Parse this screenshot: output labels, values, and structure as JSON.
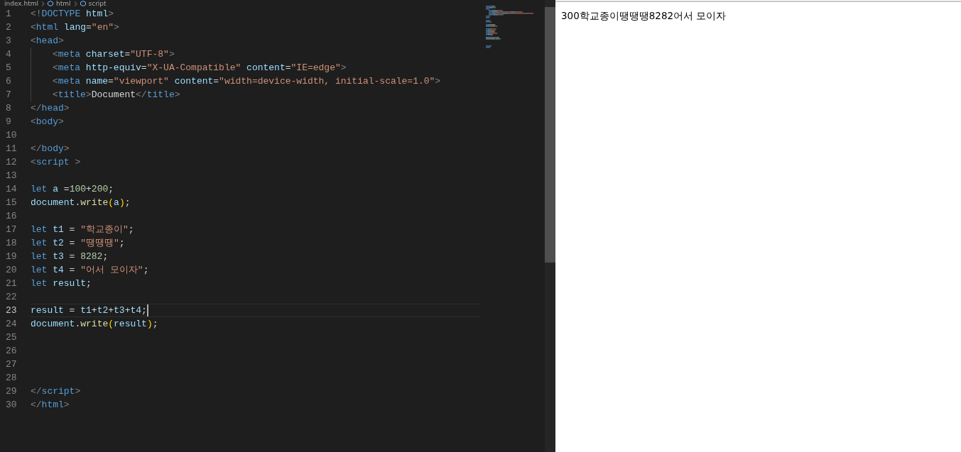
{
  "breadcrumb": [
    "index.html",
    "html",
    "script"
  ],
  "editor": {
    "lines": [
      {
        "number": "1",
        "indented": false,
        "selected": false,
        "tokens": [
          {
            "kind": "punct",
            "text": "<!"
          },
          {
            "kind": "tag",
            "text": "DOCTYPE"
          },
          {
            "kind": "attr",
            "text": " html"
          },
          {
            "kind": "punct",
            "text": ">"
          }
        ]
      },
      {
        "number": "2",
        "indented": false,
        "selected": false,
        "tokens": [
          {
            "kind": "punct",
            "text": "<"
          },
          {
            "kind": "tag",
            "text": "html"
          },
          {
            "kind": "attr",
            "text": " lang"
          },
          {
            "kind": "plain",
            "text": "="
          },
          {
            "kind": "string",
            "text": "\"en\""
          },
          {
            "kind": "punct",
            "text": ">"
          }
        ]
      },
      {
        "number": "3",
        "indented": false,
        "selected": false,
        "tokens": [
          {
            "kind": "punct",
            "text": "<"
          },
          {
            "kind": "tag",
            "text": "head"
          },
          {
            "kind": "punct",
            "text": ">"
          }
        ]
      },
      {
        "number": "4",
        "indented": true,
        "selected": false,
        "tokens": [
          {
            "kind": "punct",
            "text": "<"
          },
          {
            "kind": "tag",
            "text": "meta"
          },
          {
            "kind": "attr",
            "text": " charset"
          },
          {
            "kind": "plain",
            "text": "="
          },
          {
            "kind": "string",
            "text": "\"UTF-8\""
          },
          {
            "kind": "punct",
            "text": ">"
          }
        ]
      },
      {
        "number": "5",
        "indented": true,
        "selected": false,
        "tokens": [
          {
            "kind": "punct",
            "text": "<"
          },
          {
            "kind": "tag",
            "text": "meta"
          },
          {
            "kind": "attr",
            "text": " http-equiv"
          },
          {
            "kind": "plain",
            "text": "="
          },
          {
            "kind": "string",
            "text": "\"X-UA-Compatible\""
          },
          {
            "kind": "attr",
            "text": " content"
          },
          {
            "kind": "plain",
            "text": "="
          },
          {
            "kind": "string",
            "text": "\"IE=edge\""
          },
          {
            "kind": "punct",
            "text": ">"
          }
        ]
      },
      {
        "number": "6",
        "indented": true,
        "selected": false,
        "tokens": [
          {
            "kind": "punct",
            "text": "<"
          },
          {
            "kind": "tag",
            "text": "meta"
          },
          {
            "kind": "attr",
            "text": " name"
          },
          {
            "kind": "plain",
            "text": "="
          },
          {
            "kind": "string",
            "text": "\"viewport\""
          },
          {
            "kind": "attr",
            "text": " content"
          },
          {
            "kind": "plain",
            "text": "="
          },
          {
            "kind": "string",
            "text": "\"width=device-width, initial-scale=1.0\""
          },
          {
            "kind": "punct",
            "text": ">"
          }
        ]
      },
      {
        "number": "7",
        "indented": true,
        "selected": false,
        "tokens": [
          {
            "kind": "punct",
            "text": "<"
          },
          {
            "kind": "tag",
            "text": "title"
          },
          {
            "kind": "punct",
            "text": ">"
          },
          {
            "kind": "plain",
            "text": "Document"
          },
          {
            "kind": "punct",
            "text": "</"
          },
          {
            "kind": "tag",
            "text": "title"
          },
          {
            "kind": "punct",
            "text": ">"
          }
        ]
      },
      {
        "number": "8",
        "indented": false,
        "selected": false,
        "tokens": [
          {
            "kind": "punct",
            "text": "</"
          },
          {
            "kind": "tag",
            "text": "head"
          },
          {
            "kind": "punct",
            "text": ">"
          }
        ]
      },
      {
        "number": "9",
        "indented": false,
        "selected": false,
        "tokens": [
          {
            "kind": "punct",
            "text": "<"
          },
          {
            "kind": "tag",
            "text": "body"
          },
          {
            "kind": "punct",
            "text": ">"
          }
        ]
      },
      {
        "number": "10",
        "indented": false,
        "selected": false
      },
      {
        "number": "11",
        "indented": false,
        "selected": false,
        "tokens": [
          {
            "kind": "punct",
            "text": "</"
          },
          {
            "kind": "tag",
            "text": "body"
          },
          {
            "kind": "punct",
            "text": ">"
          }
        ]
      },
      {
        "number": "12",
        "indented": false,
        "selected": false,
        "tokens": [
          {
            "kind": "punct",
            "text": "<"
          },
          {
            "kind": "tag",
            "text": "script"
          },
          {
            "kind": "punct",
            "text": " >"
          }
        ]
      },
      {
        "number": "13",
        "indented": false,
        "selected": false
      },
      {
        "number": "14",
        "indented": false,
        "selected": false,
        "tokens": [
          {
            "kind": "keyword",
            "text": "let"
          },
          {
            "kind": "var",
            "text": " a"
          },
          {
            "kind": "plain",
            "text": " ="
          },
          {
            "kind": "number",
            "text": "100"
          },
          {
            "kind": "plain",
            "text": "+"
          },
          {
            "kind": "number",
            "text": "200"
          },
          {
            "kind": "plain",
            "text": ";"
          }
        ]
      },
      {
        "number": "15",
        "indented": false,
        "selected": false,
        "tokens": [
          {
            "kind": "var",
            "text": "document"
          },
          {
            "kind": "plain",
            "text": "."
          },
          {
            "kind": "func",
            "text": "write"
          },
          {
            "kind": "paren",
            "text": "("
          },
          {
            "kind": "var",
            "text": "a"
          },
          {
            "kind": "paren",
            "text": ")"
          },
          {
            "kind": "plain",
            "text": ";"
          }
        ]
      },
      {
        "number": "16",
        "indented": false,
        "selected": false
      },
      {
        "number": "17",
        "indented": false,
        "selected": false,
        "tokens": [
          {
            "kind": "keyword",
            "text": "let"
          },
          {
            "kind": "var",
            "text": " t1"
          },
          {
            "kind": "plain",
            "text": " = "
          },
          {
            "kind": "string",
            "text": "\"학교종이\""
          },
          {
            "kind": "plain",
            "text": ";"
          }
        ]
      },
      {
        "number": "18",
        "indented": false,
        "selected": false,
        "tokens": [
          {
            "kind": "keyword",
            "text": "let"
          },
          {
            "kind": "var",
            "text": " t2"
          },
          {
            "kind": "plain",
            "text": " = "
          },
          {
            "kind": "string",
            "text": "\"땡땡땡\""
          },
          {
            "kind": "plain",
            "text": ";"
          }
        ]
      },
      {
        "number": "19",
        "indented": false,
        "selected": false,
        "tokens": [
          {
            "kind": "keyword",
            "text": "let"
          },
          {
            "kind": "var",
            "text": " t3"
          },
          {
            "kind": "plain",
            "text": " = "
          },
          {
            "kind": "number",
            "text": "8282"
          },
          {
            "kind": "plain",
            "text": ";"
          }
        ]
      },
      {
        "number": "20",
        "indented": false,
        "selected": false,
        "tokens": [
          {
            "kind": "keyword",
            "text": "let"
          },
          {
            "kind": "var",
            "text": " t4"
          },
          {
            "kind": "plain",
            "text": " = "
          },
          {
            "kind": "string",
            "text": "\"어서 모이자\""
          },
          {
            "kind": "plain",
            "text": ";"
          }
        ]
      },
      {
        "number": "21",
        "indented": false,
        "selected": false,
        "tokens": [
          {
            "kind": "keyword",
            "text": "let"
          },
          {
            "kind": "var",
            "text": " result"
          },
          {
            "kind": "plain",
            "text": ";"
          }
        ]
      },
      {
        "number": "22",
        "indented": false,
        "selected": false
      },
      {
        "number": "23",
        "indented": false,
        "selected": true,
        "tokens": [
          {
            "kind": "var",
            "text": "result"
          },
          {
            "kind": "plain",
            "text": " = "
          },
          {
            "kind": "var",
            "text": "t1"
          },
          {
            "kind": "plain",
            "text": "+"
          },
          {
            "kind": "var",
            "text": "t2"
          },
          {
            "kind": "plain",
            "text": "+"
          },
          {
            "kind": "var",
            "text": "t3"
          },
          {
            "kind": "plain",
            "text": "+"
          },
          {
            "kind": "var",
            "text": "t4"
          },
          {
            "kind": "plain",
            "text": ";"
          }
        ]
      },
      {
        "number": "24",
        "indented": false,
        "selected": false,
        "tokens": [
          {
            "kind": "var",
            "text": "document"
          },
          {
            "kind": "plain",
            "text": "."
          },
          {
            "kind": "func",
            "text": "write"
          },
          {
            "kind": "paren",
            "text": "("
          },
          {
            "kind": "var",
            "text": "result"
          },
          {
            "kind": "paren",
            "text": ")"
          },
          {
            "kind": "plain",
            "text": ";"
          }
        ]
      },
      {
        "number": "25",
        "indented": false,
        "selected": false
      },
      {
        "number": "26",
        "indented": false,
        "selected": false
      },
      {
        "number": "27",
        "indented": false,
        "selected": false
      },
      {
        "number": "28",
        "indented": false,
        "selected": false
      },
      {
        "number": "29",
        "indented": false,
        "selected": false,
        "tokens": [
          {
            "kind": "punct",
            "text": "</"
          },
          {
            "kind": "tag",
            "text": "script"
          },
          {
            "kind": "punct",
            "text": ">"
          }
        ]
      },
      {
        "number": "30",
        "indented": false,
        "selected": false,
        "tokens": [
          {
            "kind": "punct",
            "text": "</"
          },
          {
            "kind": "tag",
            "text": "html"
          },
          {
            "kind": "punct",
            "text": ">"
          }
        ]
      }
    ]
  },
  "preview": {
    "output": "300학교종이땡땡땡8282어서 모이자"
  }
}
